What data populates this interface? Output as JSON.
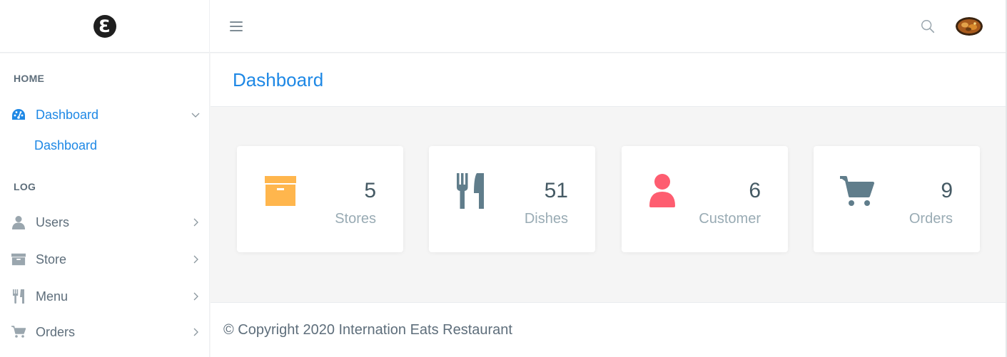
{
  "topbar": {
    "logo_letter": "Ɛ",
    "menu_icon": "hamburger-icon",
    "search_icon": "search-icon",
    "avatar": "user-avatar-food-image"
  },
  "sidebar": {
    "sections": [
      {
        "label": "HOME"
      },
      {
        "label": "LOG"
      }
    ],
    "items": [
      {
        "label": "Dashboard",
        "icon": "dashboard-gauge-icon",
        "expanded": true,
        "sub": [
          "Dashboard"
        ]
      },
      {
        "label": "Users",
        "icon": "user-icon"
      },
      {
        "label": "Store",
        "icon": "archive-box-icon"
      },
      {
        "label": "Menu",
        "icon": "cutlery-icon"
      },
      {
        "label": "Orders",
        "icon": "cart-icon"
      }
    ]
  },
  "page": {
    "title": "Dashboard"
  },
  "cards": [
    {
      "value": "5",
      "label": "Stores",
      "icon": "archive-box-icon",
      "color": "#ffb64d"
    },
    {
      "value": "51",
      "label": "Dishes",
      "icon": "cutlery-icon",
      "color": "#607d8b"
    },
    {
      "value": "6",
      "label": "Customer",
      "icon": "user-icon",
      "color": "#fe5d70"
    },
    {
      "value": "9",
      "label": "Orders",
      "icon": "cart-icon",
      "color": "#607d8b"
    }
  ],
  "footer": {
    "text": "© Copyright 2020 Internation Eats Restaurant"
  },
  "colors": {
    "accent": "#1e88e5",
    "muted": "#99abb4",
    "text": "#455a64"
  }
}
